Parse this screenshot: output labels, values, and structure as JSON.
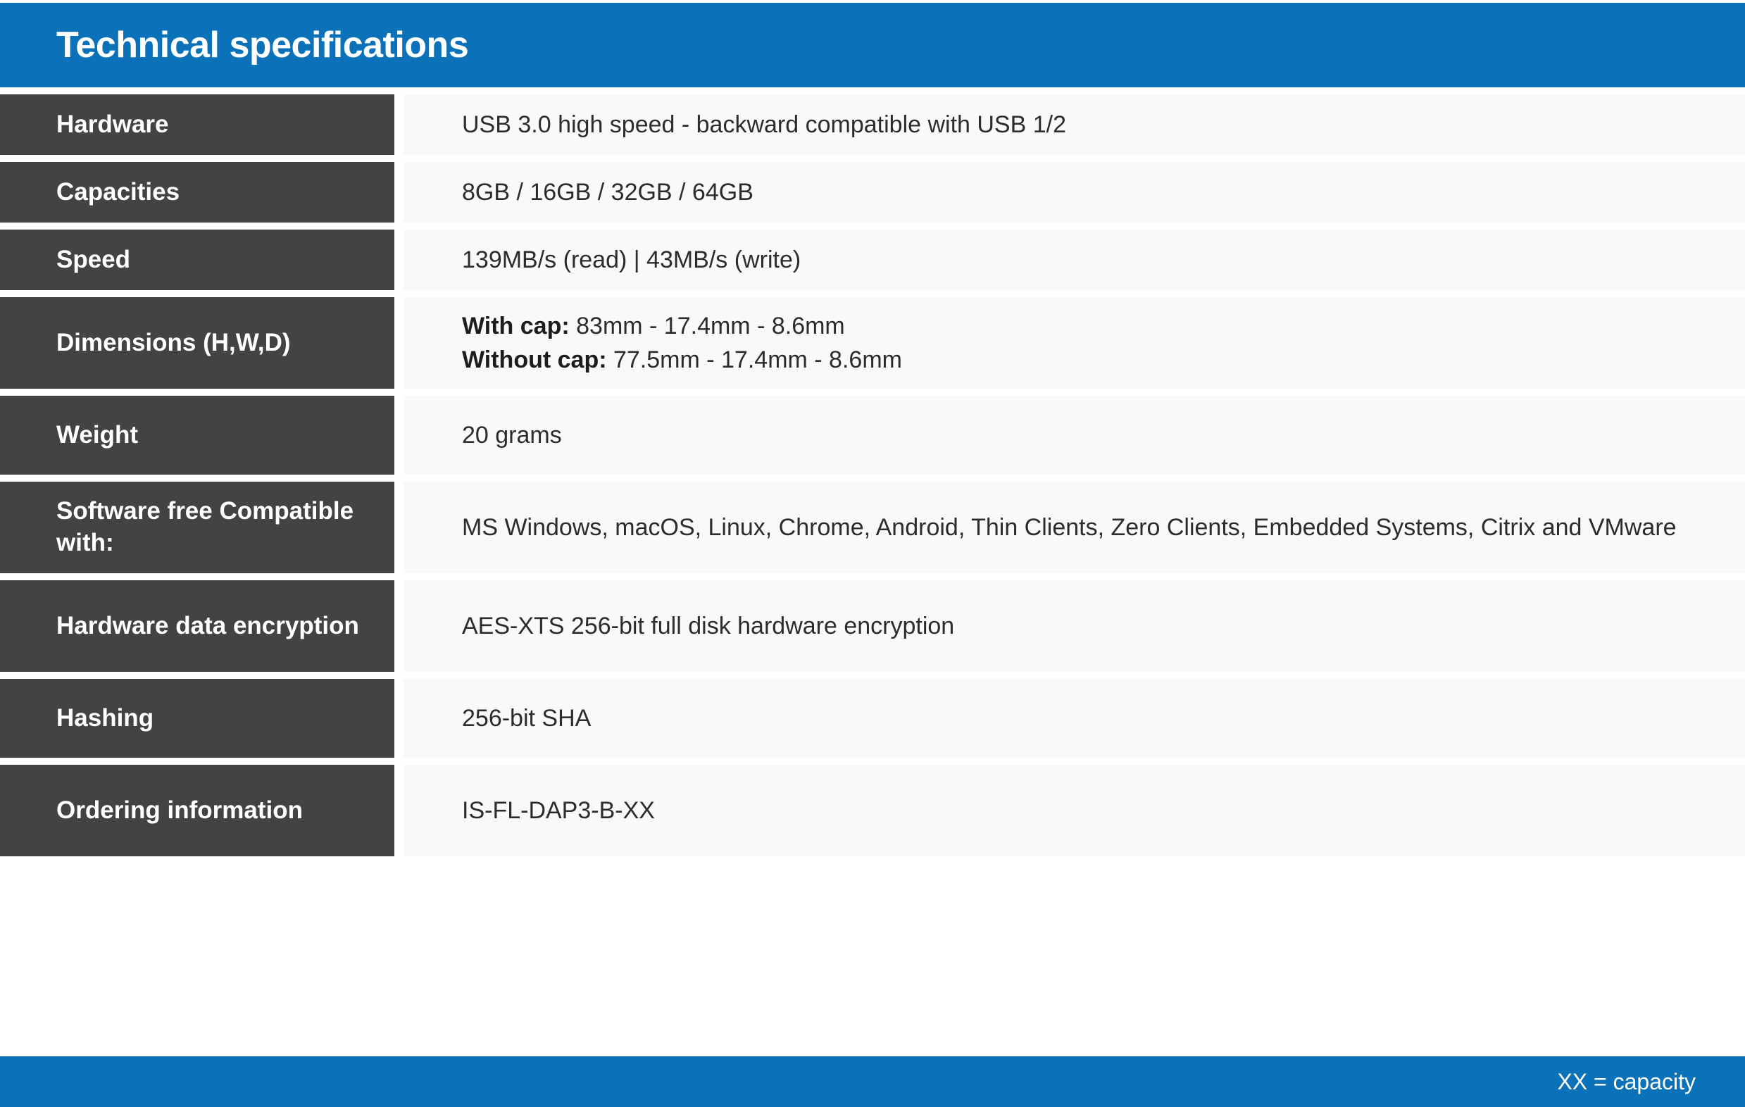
{
  "header": {
    "title": "Technical specifications",
    "background_color": "#0b72b9",
    "text_color": "#ffffff"
  },
  "theme": {
    "accent_blue": "#0b72b9",
    "label_dark": "#434343",
    "value_light": "#f9f9f9",
    "value_text": "#2c2c2c",
    "page_background": "#ffffff"
  },
  "table": {
    "rows": [
      {
        "label": "Hardware",
        "value": "USB 3.0 high speed - backward compatible with USB 1/2"
      },
      {
        "label": "Capacities",
        "value": "8GB / 16GB / 32GB / 64GB"
      },
      {
        "label": "Speed",
        "value": "139MB/s (read)  |  43MB/s (write)"
      },
      {
        "label": "Dimensions (H,W,D)",
        "line1_prefix": "With cap:",
        "line1_text": " 83mm - 17.4mm - 8.6mm",
        "line2_prefix": "Without cap:",
        "line2_text": " 77.5mm - 17.4mm - 8.6mm"
      },
      {
        "label": "Weight",
        "value": "20 grams"
      },
      {
        "label_line1": "Software free",
        "label_line2": "Compatible with:",
        "value": "MS Windows, macOS, Linux, Chrome, Android, Thin Clients, Zero Clients, Embedded Systems, Citrix and VMware"
      },
      {
        "label_line1": "Hardware data",
        "label_line2": "encryption",
        "value": "AES-XTS 256-bit full disk hardware encryption"
      },
      {
        "label": "Hashing",
        "value": "256-bit SHA"
      },
      {
        "label_line1": "Ordering",
        "label_line2": "information",
        "value": "IS-FL-DAP3-B-XX"
      }
    ]
  },
  "footer": {
    "note": "XX = capacity"
  }
}
